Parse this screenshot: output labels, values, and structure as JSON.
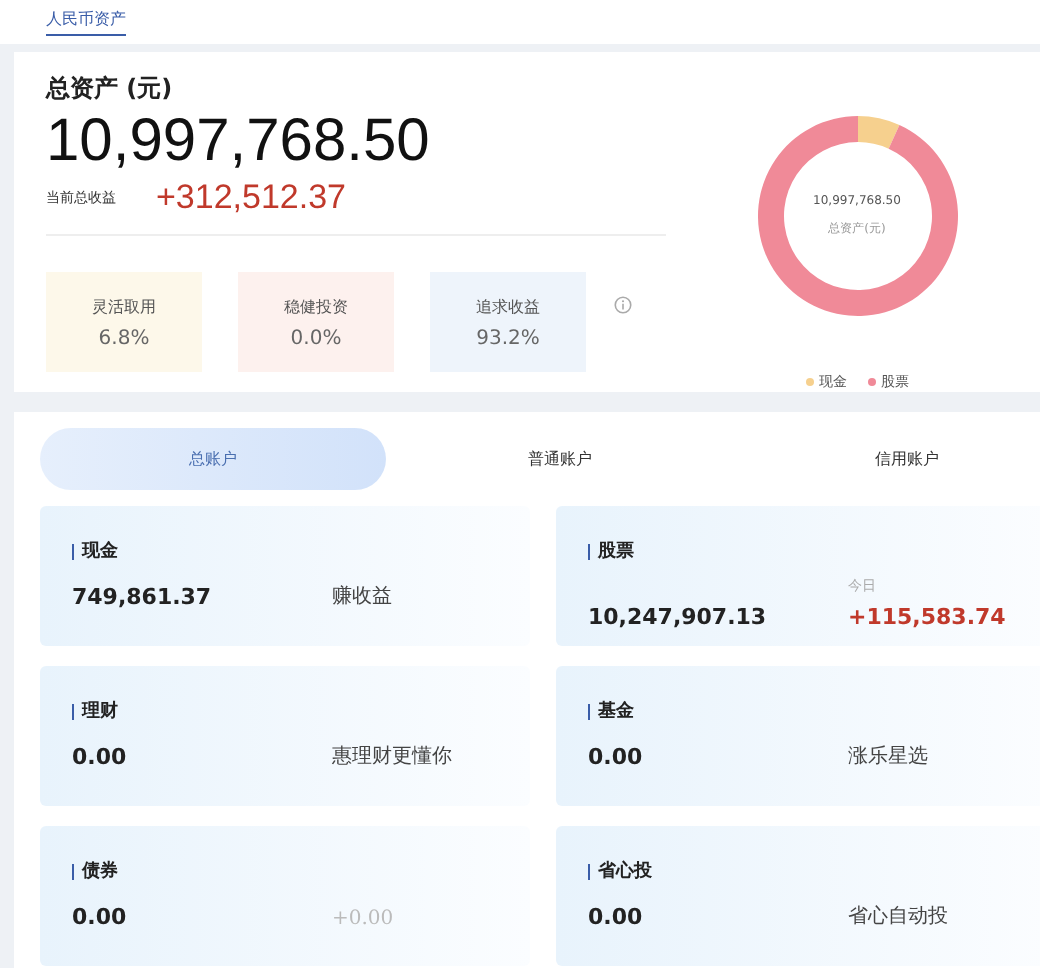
{
  "top_tab": {
    "label": "人民币资产",
    "selected": true
  },
  "summary": {
    "title": "总资产 (元)",
    "total": "10,997,768.50",
    "profit_label": "当前总收益",
    "profit": "+312,512.37",
    "allocations": [
      {
        "label": "灵活取用",
        "value": "6.8%",
        "color": "#fdf8ea"
      },
      {
        "label": "稳健投资",
        "value": "0.0%",
        "color": "#fdf1ee"
      },
      {
        "label": "追求收益",
        "value": "93.2%",
        "color": "#eef4fb"
      }
    ],
    "donut": {
      "center_value": "10,997,768.50",
      "center_label": "总资产(元)",
      "chart_data": {
        "type": "donut",
        "categories": [
          "现金",
          "股票"
        ],
        "values": [
          6.8,
          93.2
        ],
        "colors": [
          "#f6d08e",
          "#f08a98"
        ]
      }
    }
  },
  "account_tabs": [
    {
      "label": "总账户",
      "selected": true
    },
    {
      "label": "普通账户",
      "selected": false
    },
    {
      "label": "信用账户",
      "selected": false
    }
  ],
  "accounts": [
    {
      "kind": "note",
      "title": "现金",
      "value": "749,861.37",
      "note": "赚收益",
      "muted": false
    },
    {
      "kind": "today",
      "title": "股票",
      "value": "10,247,907.13",
      "today_label": "今日",
      "today_value": "+115,583.74"
    },
    {
      "kind": "note",
      "title": "理财",
      "value": "0.00",
      "note": "惠理财更懂你",
      "muted": false
    },
    {
      "kind": "note",
      "title": "基金",
      "value": "0.00",
      "note": "涨乐星选",
      "muted": false
    },
    {
      "kind": "note",
      "title": "债券",
      "value": "0.00",
      "note": "+0.00",
      "muted": true
    },
    {
      "kind": "note",
      "title": "省心投",
      "value": "0.00",
      "note": "省心自动投",
      "muted": false
    }
  ]
}
